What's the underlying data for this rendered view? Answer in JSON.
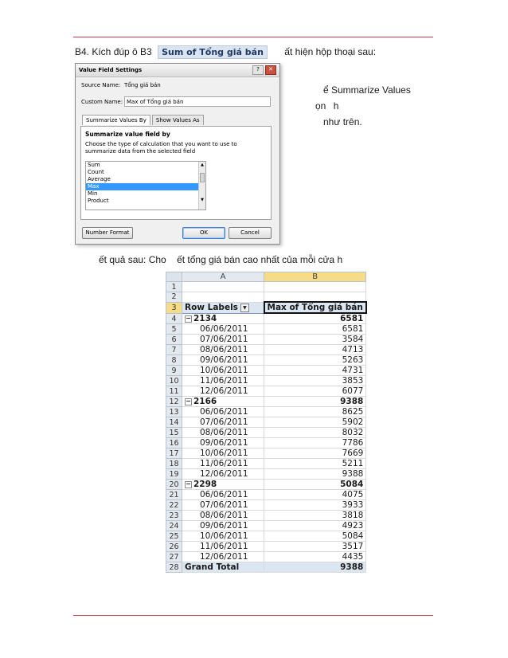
{
  "doc": {
    "line1_prefix": "B4. Kích đúp ô B3",
    "line1_chip": "Sum of Tổng giá bán",
    "line1_suffix": "ất hiện hộp thoại sau:",
    "side_line1": "ể Summarize Values",
    "side_line2a": "ọn",
    "side_line2b": "h",
    "side_line3": "như trên.",
    "result_line": "ết quả sau: Cho    ết tổng giá bán cao nhất của mỗi cửa h",
    "rule_color": "#b8414a"
  },
  "dialog": {
    "title": "Value Field Settings",
    "source_label": "Source Name:",
    "source_value": "Tổng giá bán",
    "custom_label": "Custom Name:",
    "custom_value": "Max of Tổng giá bán",
    "tab1": "Summarize Values By",
    "tab2": "Show Values As",
    "section_title": "Summarize value field by",
    "description": "Choose the type of calculation that you want to use to summarize data from the selected field",
    "options": [
      "Sum",
      "Count",
      "Average",
      "Max",
      "Min",
      "Product"
    ],
    "selected_option": "Max",
    "number_format": "Number Format",
    "ok": "OK",
    "cancel": "Cancel"
  },
  "sheet": {
    "col_a": "A",
    "col_b": "B",
    "header_a": "Row Labels",
    "header_b": "Max of Tổng giá bán",
    "rows": [
      {
        "n": "1",
        "a": "",
        "b": "",
        "kind": "blank"
      },
      {
        "n": "2",
        "a": "",
        "b": "",
        "kind": "blank"
      },
      {
        "n": "3",
        "a": "Row Labels",
        "b": "Max of Tổng giá bán",
        "kind": "hdr"
      },
      {
        "n": "4",
        "a": "2134",
        "b": "6581",
        "kind": "grp"
      },
      {
        "n": "5",
        "a": "06/06/2011",
        "b": "6581",
        "kind": "item"
      },
      {
        "n": "6",
        "a": "07/06/2011",
        "b": "3584",
        "kind": "item"
      },
      {
        "n": "7",
        "a": "08/06/2011",
        "b": "4713",
        "kind": "item"
      },
      {
        "n": "8",
        "a": "09/06/2011",
        "b": "5263",
        "kind": "item"
      },
      {
        "n": "9",
        "a": "10/06/2011",
        "b": "4731",
        "kind": "item"
      },
      {
        "n": "10",
        "a": "11/06/2011",
        "b": "3853",
        "kind": "item"
      },
      {
        "n": "11",
        "a": "12/06/2011",
        "b": "6077",
        "kind": "item"
      },
      {
        "n": "12",
        "a": "2166",
        "b": "9388",
        "kind": "grp"
      },
      {
        "n": "13",
        "a": "06/06/2011",
        "b": "8625",
        "kind": "item"
      },
      {
        "n": "14",
        "a": "07/06/2011",
        "b": "5902",
        "kind": "item"
      },
      {
        "n": "15",
        "a": "08/06/2011",
        "b": "8032",
        "kind": "item"
      },
      {
        "n": "16",
        "a": "09/06/2011",
        "b": "7786",
        "kind": "item"
      },
      {
        "n": "17",
        "a": "10/06/2011",
        "b": "7669",
        "kind": "item"
      },
      {
        "n": "18",
        "a": "11/06/2011",
        "b": "5211",
        "kind": "item"
      },
      {
        "n": "19",
        "a": "12/06/2011",
        "b": "9388",
        "kind": "item"
      },
      {
        "n": "20",
        "a": "2298",
        "b": "5084",
        "kind": "grp"
      },
      {
        "n": "21",
        "a": "06/06/2011",
        "b": "4075",
        "kind": "item"
      },
      {
        "n": "22",
        "a": "07/06/2011",
        "b": "3933",
        "kind": "item"
      },
      {
        "n": "23",
        "a": "08/06/2011",
        "b": "3818",
        "kind": "item"
      },
      {
        "n": "24",
        "a": "09/06/2011",
        "b": "4923",
        "kind": "item"
      },
      {
        "n": "25",
        "a": "10/06/2011",
        "b": "5084",
        "kind": "item"
      },
      {
        "n": "26",
        "a": "11/06/2011",
        "b": "3517",
        "kind": "item"
      },
      {
        "n": "27",
        "a": "12/06/2011",
        "b": "4435",
        "kind": "item"
      },
      {
        "n": "28",
        "a": "Grand Total",
        "b": "9388",
        "kind": "total"
      }
    ]
  }
}
